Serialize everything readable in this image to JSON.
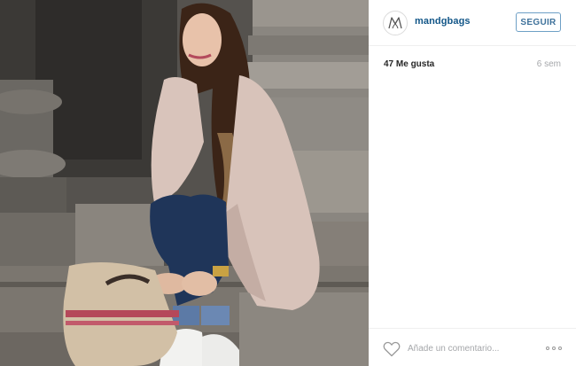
{
  "post": {
    "username": "mandgbags",
    "follow_label": "SEGUIR",
    "likes_text": "47 Me gusta",
    "time_ago": "6 sem"
  },
  "comment": {
    "placeholder": "Añade un comentario..."
  },
  "icons": {
    "avatar": "mandg-logo-icon",
    "like": "heart-icon",
    "options": "more-options-icon"
  },
  "colors": {
    "username": "#125688",
    "follow_border": "#6ea0c6",
    "follow_text": "#3f729b",
    "muted": "#a5a7aa"
  }
}
